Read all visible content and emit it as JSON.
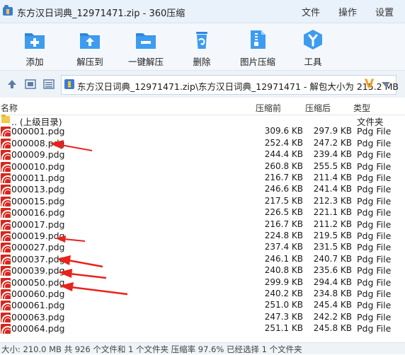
{
  "window": {
    "title": "东方汉日词典_12971471.zip - 360压缩",
    "menu": [
      "文件",
      "操作",
      "设置"
    ]
  },
  "toolbar": {
    "buttons": [
      {
        "label": "添加",
        "icon": "add-icon"
      },
      {
        "label": "解压到",
        "icon": "extract-to-icon"
      },
      {
        "label": "一键解压",
        "icon": "one-click-extract-icon"
      },
      {
        "label": "删除",
        "icon": "delete-icon"
      },
      {
        "label": "图片压缩",
        "icon": "image-compress-icon"
      },
      {
        "label": "工具",
        "icon": "tools-icon"
      }
    ]
  },
  "address": {
    "path": "东方汉日词典_12971471.zip\\东方汉日词典_12971471 - 解包大小为 215.2 MB"
  },
  "columns": {
    "name": "名称",
    "before": "压缩前",
    "after": "压缩后",
    "type": "类型"
  },
  "parent_row": {
    "name": ".. (上级目录)",
    "type": "文件夹"
  },
  "files": [
    {
      "name": "000001.pdg",
      "before": "309.6 KB",
      "after": "297.9 KB",
      "type": "Pdg File"
    },
    {
      "name": "000008.pdg",
      "before": "252.4 KB",
      "after": "247.2 KB",
      "type": "Pdg File"
    },
    {
      "name": "000009.pdg",
      "before": "244.4 KB",
      "after": "239.4 KB",
      "type": "Pdg File"
    },
    {
      "name": "000010.pdg",
      "before": "260.8 KB",
      "after": "255.5 KB",
      "type": "Pdg File"
    },
    {
      "name": "000011.pdg",
      "before": "216.7 KB",
      "after": "211.4 KB",
      "type": "Pdg File"
    },
    {
      "name": "000013.pdg",
      "before": "246.6 KB",
      "after": "241.4 KB",
      "type": "Pdg File"
    },
    {
      "name": "000015.pdg",
      "before": "217.5 KB",
      "after": "212.3 KB",
      "type": "Pdg File"
    },
    {
      "name": "000016.pdg",
      "before": "226.5 KB",
      "after": "221.1 KB",
      "type": "Pdg File"
    },
    {
      "name": "000017.pdg",
      "before": "216.7 KB",
      "after": "211.2 KB",
      "type": "Pdg File"
    },
    {
      "name": "000019.pdg",
      "before": "224.8 KB",
      "after": "219.5 KB",
      "type": "Pdg File"
    },
    {
      "name": "000027.pdg",
      "before": "237.4 KB",
      "after": "231.5 KB",
      "type": "Pdg File"
    },
    {
      "name": "000037.pdg",
      "before": "246.1 KB",
      "after": "240.7 KB",
      "type": "Pdg File"
    },
    {
      "name": "000039.pdg",
      "before": "240.8 KB",
      "after": "235.6 KB",
      "type": "Pdg File"
    },
    {
      "name": "000050.pdg",
      "before": "299.9 KB",
      "after": "294.4 KB",
      "type": "Pdg File"
    },
    {
      "name": "000060.pdg",
      "before": "240.2 KB",
      "after": "234.8 KB",
      "type": "Pdg File"
    },
    {
      "name": "000061.pdg",
      "before": "251.0 KB",
      "after": "245.4 KB",
      "type": "Pdg File"
    },
    {
      "name": "000063.pdg",
      "before": "247.3 KB",
      "after": "242.2 KB",
      "type": "Pdg File"
    },
    {
      "name": "000064.pdg",
      "before": "251.1 KB",
      "after": "245.8 KB",
      "type": "Pdg File"
    }
  ],
  "status": {
    "text": "大小: 210.0 MB 共 926 个文件和 1 个文件夹 压缩率 97.6% 已经选择 1 个文件夹"
  },
  "colors": {
    "accent": "#3a7bd5",
    "annotation": "#e8221c",
    "pdg_icon": "#d9261c"
  }
}
